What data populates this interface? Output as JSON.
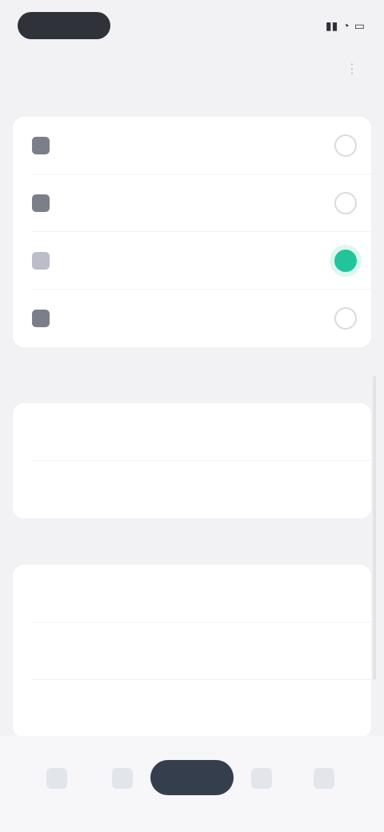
{
  "status_bar": {
    "time": "",
    "right_icons": [
      "signal-icon",
      "wifi-icon",
      "battery-icon"
    ]
  },
  "header": {
    "title": "",
    "more_icon": "more-icon"
  },
  "sections": [
    {
      "label": "",
      "items": [
        {
          "label": "",
          "selected": false
        },
        {
          "label": "",
          "selected": false
        },
        {
          "label": "",
          "selected": true
        },
        {
          "label": "",
          "selected": false
        }
      ]
    },
    {
      "label": "",
      "items": [
        {
          "label": ""
        },
        {
          "label": ""
        }
      ]
    },
    {
      "label": "",
      "items": [
        {
          "label": ""
        },
        {
          "label": ""
        },
        {
          "label": ""
        }
      ]
    }
  ],
  "bottom_nav": {
    "items": [
      "home-icon",
      "search-icon",
      "center-action",
      "chat-icon",
      "profile-icon"
    ]
  },
  "colors": {
    "accent": "#22c59b",
    "background": "#f2f2f5",
    "card": "#ffffff"
  }
}
